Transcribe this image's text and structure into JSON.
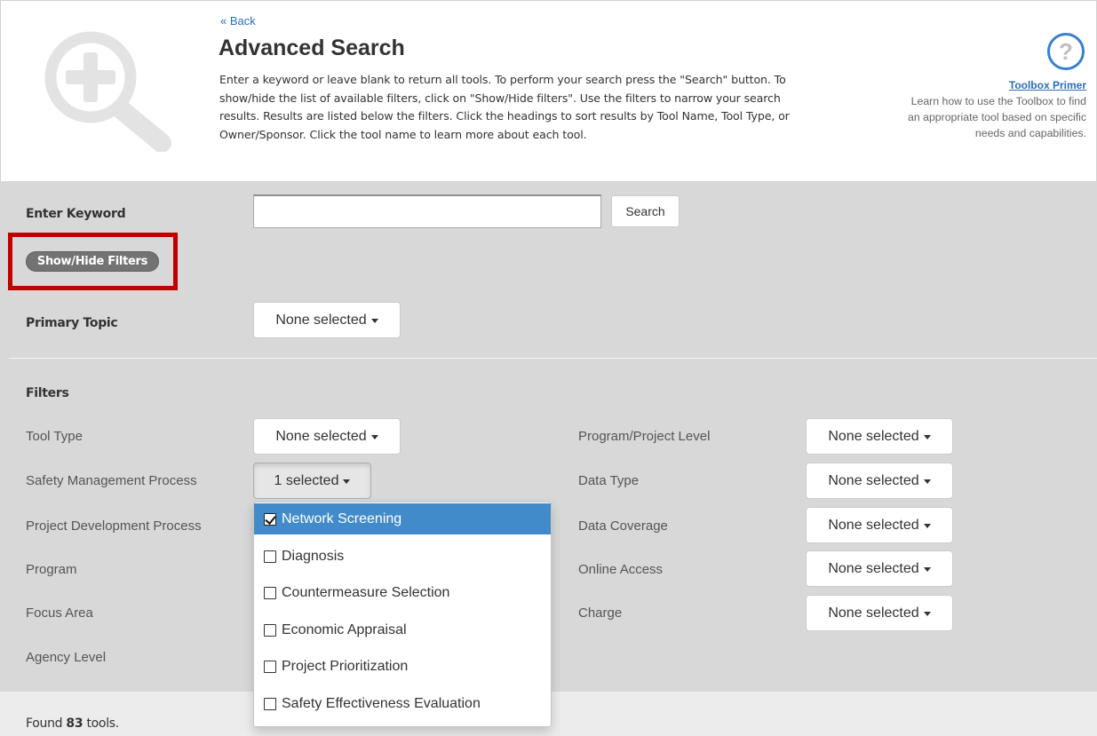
{
  "header": {
    "back_link": "« Back",
    "title": "Advanced Search",
    "intro_lines": [
      "Enter a keyword or leave blank to return all tools. To perform your search press the \"Search\" button. To",
      "show/hide the list of available filters, click on \"Show/Hide filters\". Use the filters to narrow your search",
      "results. Results are listed below the filters. Click the headings to sort results by Tool Name, Tool Type, or",
      "Owner/Sponsor. Click the tool name to learn more about each tool."
    ],
    "help_icon": "question-circle-icon",
    "primer_title": "Toolbox Primer",
    "primer_lines": [
      "Learn how to use the Toolbox to find",
      "an appropriate tool based on specific",
      "needs and capabilities."
    ]
  },
  "search": {
    "keyword_label": "Enter Keyword",
    "keyword_value": "",
    "search_button": "Search",
    "toggle_filters": "Show/Hide Filters"
  },
  "primary_topic": {
    "label": "Primary Topic",
    "value": "None selected"
  },
  "filters": {
    "heading": "Filters",
    "left": [
      {
        "label": "Tool Type",
        "value": "None selected"
      },
      {
        "label": "Safety Management Process",
        "value": "1 selected"
      },
      {
        "label": "Project Development Process"
      },
      {
        "label": "Program"
      },
      {
        "label": "Focus Area"
      },
      {
        "label": "Agency Level"
      }
    ],
    "right": [
      {
        "label": "Program/Project Level",
        "value": "None selected"
      },
      {
        "label": "Data Type",
        "value": "None selected"
      },
      {
        "label": "Data Coverage",
        "value": "None selected"
      },
      {
        "label": "Online Access",
        "value": "None selected"
      },
      {
        "label": "Charge",
        "value": "None selected"
      }
    ]
  },
  "safety_menu": {
    "options": [
      {
        "label": "Network Screening",
        "checked": true
      },
      {
        "label": "Diagnosis",
        "checked": false
      },
      {
        "label": "Countermeasure Selection",
        "checked": false
      },
      {
        "label": "Economic Appraisal",
        "checked": false
      },
      {
        "label": "Project Prioritization",
        "checked": false
      },
      {
        "label": "Safety Effectiveness Evaluation",
        "checked": false
      }
    ]
  },
  "results": {
    "prefix": "Found",
    "count": "83",
    "suffix": "tools."
  },
  "colors": {
    "link": "#2a6ebb",
    "panel": "#d8d8d8",
    "highlight": "#c00000",
    "selected": "#428bca"
  }
}
